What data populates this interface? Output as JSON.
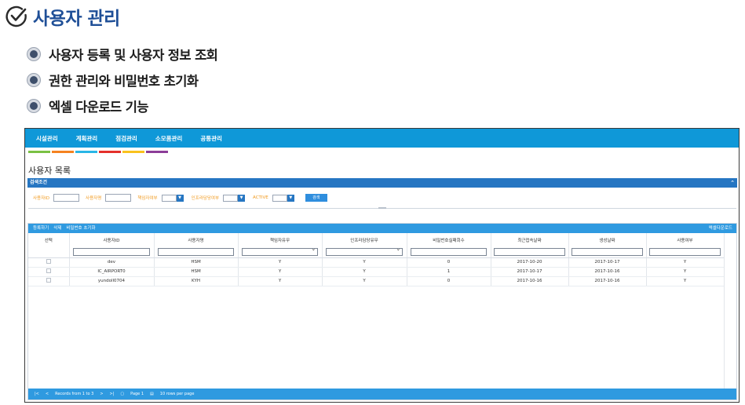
{
  "slide": {
    "title": "사용자 관리",
    "bullets": [
      "사용자 등록 및 사용자 정보 조회",
      "권한 관리와 비밀번호 초기화",
      "엑셀 다운로드 기능"
    ]
  },
  "app": {
    "nav": [
      "시설관리",
      "계획관리",
      "점검관리",
      "소모품관리",
      "공통관리"
    ],
    "colors": [
      "#7ac143",
      "#f58220",
      "#29b6e6",
      "#e4302b",
      "#f9c21d",
      "#8c3d98"
    ],
    "page_title": "사용자 목록",
    "search": {
      "header": "검색조건",
      "labels": [
        "사용자ID",
        "사용자명",
        "책임자여부",
        "인프라담당여부",
        "ACTIVE"
      ],
      "button": "검색"
    },
    "grid": {
      "toolbar": [
        "등록하기",
        "삭제",
        "비밀번호 초기화"
      ],
      "excel": "엑셀다운로드",
      "columns": [
        "선택",
        "사용자ID",
        "사용자명",
        "책임자유무",
        "인프라담당유무",
        "비밀번호실패회수",
        "최근접속날짜",
        "생성날짜",
        "사용여부"
      ],
      "rows": [
        [
          "dev",
          "HSM",
          "Y",
          "Y",
          "0",
          "2017-10-20",
          "2017-10-17",
          "Y"
        ],
        [
          "IC_AIRPORT0",
          "HSM",
          "Y",
          "Y",
          "1",
          "2017-10-17",
          "2017-10-16",
          "Y"
        ],
        [
          "yundoll0704",
          "KYH",
          "Y",
          "Y",
          "0",
          "2017-10-16",
          "2017-10-16",
          "Y"
        ]
      ]
    },
    "pager": {
      "records": "Records from 1 to 3",
      "page": "Page 1",
      "per_page": "10 rows per page"
    }
  }
}
